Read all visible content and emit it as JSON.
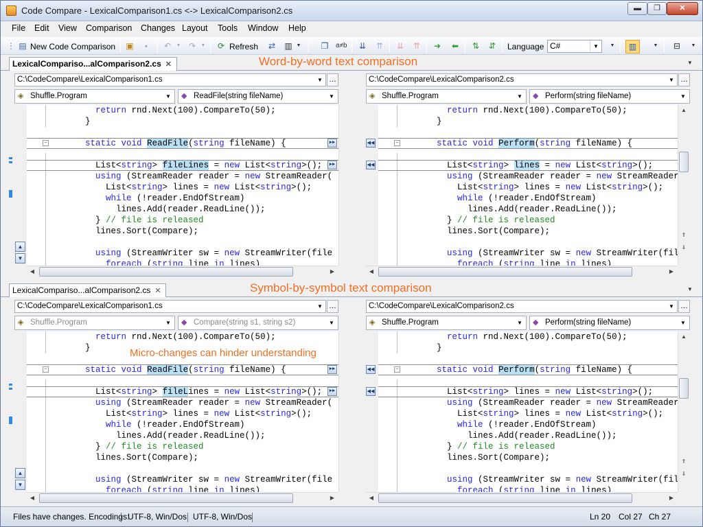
{
  "window": {
    "title": "Code Compare - LexicalComparison1.cs <-> LexicalComparison2.cs",
    "min": "▬",
    "max": "❐",
    "close": "✕"
  },
  "menu": [
    "File",
    "Edit",
    "View",
    "Comparison",
    "Changes",
    "Layout",
    "Tools",
    "Window",
    "Help"
  ],
  "toolbar": {
    "new_comparison": "New Code Comparison",
    "refresh": "Refresh",
    "language_label": "Language",
    "language_value": "C#"
  },
  "pane1": {
    "tab": "LexicalCompariso...alComparison2.cs",
    "title": "Word-by-word text comparison",
    "left": {
      "path": "C:\\CodeCompare\\LexicalComparison1.cs",
      "class": "Shuffle.Program",
      "method": "ReadFile(string fileName)",
      "method_dim": false
    },
    "right": {
      "path": "C:\\CodeCompare\\LexicalComparison2.cs",
      "class": "Shuffle.Program",
      "method": "Perform(string fileName)"
    }
  },
  "pane2": {
    "tab": "LexicalCompariso...alComparison2.cs",
    "title": "Symbol-by-symbol text comparison",
    "annotation": "Micro-changes can hinder understanding",
    "left": {
      "path": "C:\\CodeCompare\\LexicalComparison1.cs",
      "class": "Shuffle.Program",
      "method": "Compare(string s1, string s2)",
      "method_dim": true
    },
    "right": {
      "path": "C:\\CodeCompare\\LexicalComparison2.cs",
      "class": "Shuffle.Program",
      "method": "Perform(string fileName)"
    }
  },
  "code": {
    "left": [
      [
        "        ",
        {
          "t": "return",
          "k": "kw"
        },
        " rnd.Next(100).CompareTo(50);"
      ],
      [
        "      }"
      ],
      [
        ""
      ],
      [
        "      ",
        {
          "t": "static",
          "k": "kw"
        },
        " ",
        {
          "t": "void",
          "k": "kw"
        },
        " ",
        {
          "t": "ReadFile",
          "k": "hl"
        },
        "(",
        {
          "t": "string",
          "k": "kw"
        },
        " fileName) {"
      ],
      [
        ""
      ],
      [
        "        List<",
        {
          "t": "string",
          "k": "kw"
        },
        "> ",
        {
          "t": "fileLines",
          "k": "hl"
        },
        " = ",
        {
          "t": "new",
          "k": "kw"
        },
        " List<",
        {
          "t": "string",
          "k": "kw"
        },
        ">();"
      ],
      [
        "        ",
        {
          "t": "using",
          "k": "kw"
        },
        " (StreamReader reader = ",
        {
          "t": "new",
          "k": "kw"
        },
        " StreamReader("
      ],
      [
        "          List<",
        {
          "t": "string",
          "k": "kw"
        },
        "> lines = ",
        {
          "t": "new",
          "k": "kw"
        },
        " List<",
        {
          "t": "string",
          "k": "kw"
        },
        ">();"
      ],
      [
        "          ",
        {
          "t": "while",
          "k": "kw"
        },
        " (!reader.EndOfStream)"
      ],
      [
        "            lines.Add(reader.ReadLine());"
      ],
      [
        "        } ",
        {
          "t": "// file is released",
          "k": "cm"
        }
      ],
      [
        "        lines.Sort(Compare);"
      ],
      [
        ""
      ],
      [
        "        ",
        {
          "t": "using",
          "k": "kw"
        },
        " (StreamWriter sw = ",
        {
          "t": "new",
          "k": "kw"
        },
        " StreamWriter(file"
      ],
      [
        "          ",
        {
          "t": "foreach",
          "k": "kw"
        },
        " (",
        {
          "t": "string",
          "k": "kw"
        },
        " line ",
        {
          "t": "in",
          "k": "kw"
        },
        " lines)"
      ]
    ],
    "right": [
      [
        "        ",
        {
          "t": "return",
          "k": "kw"
        },
        " rnd.Next(100).CompareTo(50);"
      ],
      [
        "      }"
      ],
      [
        ""
      ],
      [
        "      ",
        {
          "t": "static",
          "k": "kw"
        },
        " ",
        {
          "t": "void",
          "k": "kw"
        },
        " ",
        {
          "t": "Perform",
          "k": "hl"
        },
        "(",
        {
          "t": "string",
          "k": "kw"
        },
        " fileName) {"
      ],
      [
        ""
      ],
      [
        "        List<",
        {
          "t": "string",
          "k": "kw"
        },
        "> ",
        {
          "t": "lines",
          "k": "hl"
        },
        " = ",
        {
          "t": "new",
          "k": "kw"
        },
        " List<",
        {
          "t": "string",
          "k": "kw"
        },
        ">();"
      ],
      [
        "        ",
        {
          "t": "using",
          "k": "kw"
        },
        " (StreamReader reader = ",
        {
          "t": "new",
          "k": "kw"
        },
        " StreamReader("
      ],
      [
        "          List<",
        {
          "t": "string",
          "k": "kw"
        },
        "> lines = ",
        {
          "t": "new",
          "k": "kw"
        },
        " List<",
        {
          "t": "string",
          "k": "kw"
        },
        ">();"
      ],
      [
        "          ",
        {
          "t": "while",
          "k": "kw"
        },
        " (!reader.EndOfStream)"
      ],
      [
        "            lines.Add(reader.ReadLine());"
      ],
      [
        "        } ",
        {
          "t": "// file is released",
          "k": "cm"
        }
      ],
      [
        "        lines.Sort(Compare);"
      ],
      [
        ""
      ],
      [
        "        ",
        {
          "t": "using",
          "k": "kw"
        },
        " (StreamWriter sw = ",
        {
          "t": "new",
          "k": "kw"
        },
        " StreamWriter(file"
      ],
      [
        "          ",
        {
          "t": "foreach",
          "k": "kw"
        },
        " (",
        {
          "t": "string",
          "k": "kw"
        },
        " line ",
        {
          "t": "in",
          "k": "kw"
        },
        " lines)"
      ]
    ],
    "left2": [
      [
        "        ",
        {
          "t": "return",
          "k": "kw"
        },
        " rnd.Next(100).CompareTo(50);"
      ],
      [
        "      }"
      ],
      [
        ""
      ],
      [
        "      ",
        {
          "t": "static",
          "k": "kw"
        },
        " ",
        {
          "t": "void",
          "k": "kw"
        },
        " ",
        {
          "t": "ReadFile",
          "k": "hl"
        },
        "(",
        {
          "t": "string",
          "k": "kw"
        },
        " fileName) {"
      ],
      [
        ""
      ],
      [
        "        List<",
        {
          "t": "string",
          "k": "kw"
        },
        "> ",
        {
          "t": "fileL",
          "k": "hl"
        },
        "ines = ",
        {
          "t": "new",
          "k": "kw"
        },
        " List<",
        {
          "t": "string",
          "k": "kw"
        },
        ">();"
      ],
      [
        "        ",
        {
          "t": "using",
          "k": "kw"
        },
        " (StreamReader reader = ",
        {
          "t": "new",
          "k": "kw"
        },
        " StreamReader("
      ],
      [
        "          List<",
        {
          "t": "string",
          "k": "kw"
        },
        "> lines = ",
        {
          "t": "new",
          "k": "kw"
        },
        " List<",
        {
          "t": "string",
          "k": "kw"
        },
        ">();"
      ],
      [
        "          ",
        {
          "t": "while",
          "k": "kw"
        },
        " (!reader.EndOfStream)"
      ],
      [
        "            lines.Add(reader.ReadLine());"
      ],
      [
        "        } ",
        {
          "t": "// file is released",
          "k": "cm"
        }
      ],
      [
        "        lines.Sort(Compare);"
      ],
      [
        ""
      ],
      [
        "        ",
        {
          "t": "using",
          "k": "kw"
        },
        " (StreamWriter sw = ",
        {
          "t": "new",
          "k": "kw"
        },
        " StreamWriter(file"
      ],
      [
        "          ",
        {
          "t": "foreach",
          "k": "kw"
        },
        " (",
        {
          "t": "string",
          "k": "kw"
        },
        " line ",
        {
          "t": "in",
          "k": "kw"
        },
        " lines)"
      ]
    ],
    "right2": [
      [
        "        ",
        {
          "t": "return",
          "k": "kw"
        },
        " rnd.Next(100).CompareTo(50);"
      ],
      [
        "      }"
      ],
      [
        ""
      ],
      [
        "      ",
        {
          "t": "static",
          "k": "kw"
        },
        " ",
        {
          "t": "void",
          "k": "kw"
        },
        " ",
        {
          "t": "Perform",
          "k": "hl"
        },
        "(",
        {
          "t": "string",
          "k": "kw"
        },
        " fileName) {"
      ],
      [
        ""
      ],
      [
        "        List<",
        {
          "t": "string",
          "k": "kw"
        },
        "> lines = ",
        {
          "t": "new",
          "k": "kw"
        },
        " List<",
        {
          "t": "string",
          "k": "kw"
        },
        ">();"
      ],
      [
        "        ",
        {
          "t": "using",
          "k": "kw"
        },
        " (StreamReader reader = ",
        {
          "t": "new",
          "k": "kw"
        },
        " StreamReader("
      ],
      [
        "          List<",
        {
          "t": "string",
          "k": "kw"
        },
        "> lines = ",
        {
          "t": "new",
          "k": "kw"
        },
        " List<",
        {
          "t": "string",
          "k": "kw"
        },
        ">();"
      ],
      [
        "          ",
        {
          "t": "while",
          "k": "kw"
        },
        " (!reader.EndOfStream)"
      ],
      [
        "            lines.Add(reader.ReadLine());"
      ],
      [
        "        } ",
        {
          "t": "// file is released",
          "k": "cm"
        }
      ],
      [
        "        lines.Sort(Compare);"
      ],
      [
        ""
      ],
      [
        "        ",
        {
          "t": "using",
          "k": "kw"
        },
        " (StreamWriter sw = ",
        {
          "t": "new",
          "k": "kw"
        },
        " StreamWriter(file"
      ],
      [
        "          ",
        {
          "t": "foreach",
          "k": "kw"
        },
        " (",
        {
          "t": "string",
          "k": "kw"
        },
        " line ",
        {
          "t": "in",
          "k": "kw"
        },
        " lines)"
      ]
    ]
  },
  "status": {
    "message": "Files have changes. Encodings:",
    "enc1": "UTF-8, Win/Dos",
    "enc2": "UTF-8, Win/Dos",
    "ln": "Ln 20",
    "col": "Col 27",
    "ch": "Ch 27"
  },
  "colors": {
    "accent_orange": "#f26e22",
    "keyword": "#2626e6",
    "comment": "#1e8a1e",
    "highlight": "#b9e0f5"
  }
}
